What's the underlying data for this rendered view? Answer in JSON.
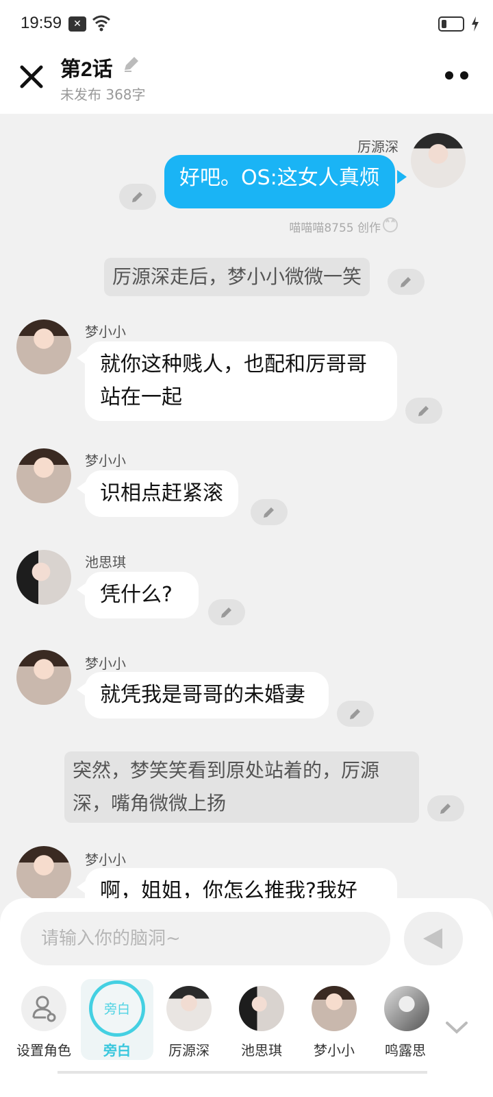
{
  "status_bar": {
    "time": "19:59",
    "notification_icon": "x-notification-icon",
    "wifi_icon": "wifi-icon",
    "battery_icon": "battery-icon",
    "charging_icon": "charging-icon"
  },
  "header": {
    "title": "第2话",
    "subtitle": "未发布 368字"
  },
  "chat": {
    "messages": [
      {
        "type": "self",
        "name": "厉源深",
        "text": "好吧。OS:这女人真烦",
        "credit": "喵喵喵8755 创作"
      },
      {
        "type": "narration",
        "text": "厉源深走后，梦小小微微一笑"
      },
      {
        "type": "other",
        "name": "梦小小",
        "lines": [
          "就你这种贱人，也配和厉哥哥",
          "站在一起"
        ]
      },
      {
        "type": "other",
        "name": "梦小小",
        "text": "识相点赶紧滚"
      },
      {
        "type": "other",
        "name": "池思琪",
        "text": "凭什么?"
      },
      {
        "type": "other",
        "name": "梦小小",
        "text": "就凭我是哥哥的未婚妻"
      },
      {
        "type": "narration",
        "lines": [
          "突然，梦笑笑看到原处站着的，厉源",
          "深，嘴角微微上扬"
        ]
      },
      {
        "type": "other",
        "name": "梦小小",
        "text": "啊，姐姐，你怎么推我?我好"
      }
    ]
  },
  "composer": {
    "placeholder": "请输入你的脑洞~"
  },
  "roles": [
    {
      "label": "设置角色"
    },
    {
      "label": "旁白",
      "circle_text": "旁白",
      "active": true
    },
    {
      "label": "厉源深"
    },
    {
      "label": "池思琪"
    },
    {
      "label": "梦小小"
    },
    {
      "label": "鸣露思"
    }
  ],
  "colors": {
    "accent_blue": "#1ab4f5",
    "narration_active": "#44d0e2"
  }
}
